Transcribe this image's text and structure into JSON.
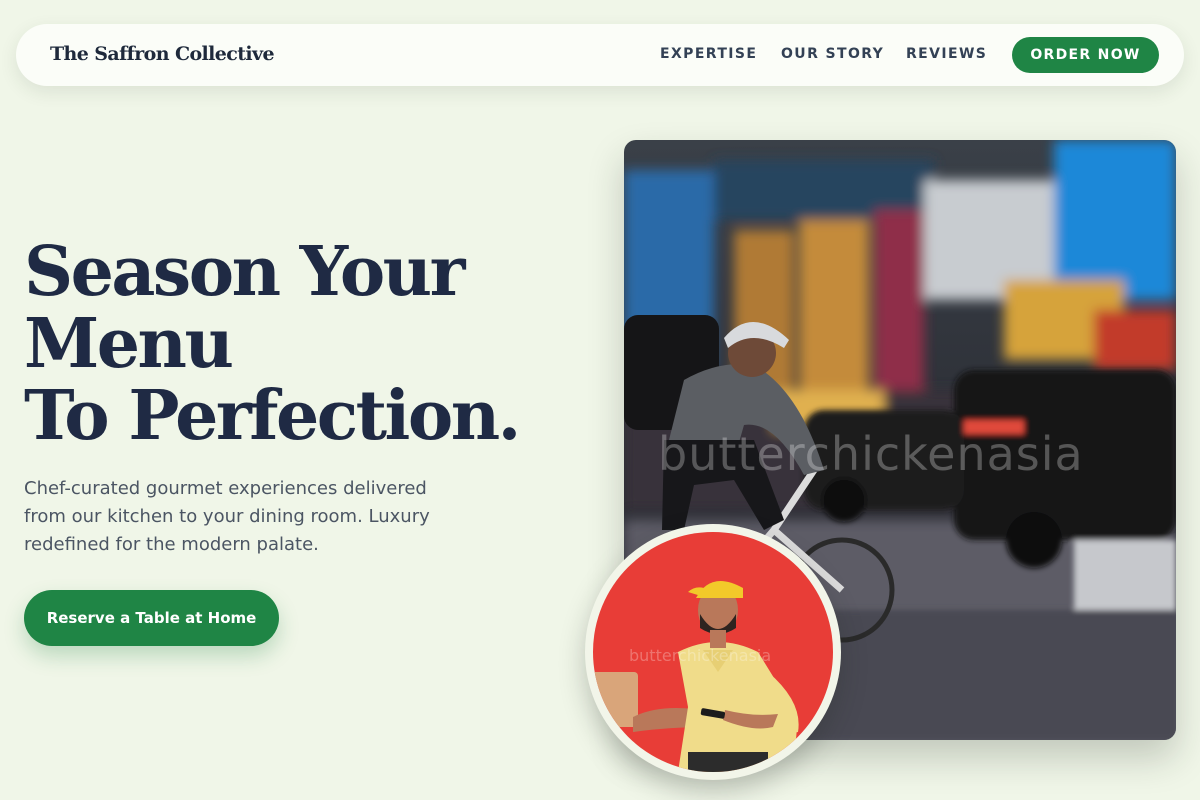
{
  "nav": {
    "brand": "The Saffron Collective",
    "links": [
      "EXPERTISE",
      "OUR STORY",
      "REVIEWS"
    ],
    "cta": "ORDER NOW"
  },
  "hero": {
    "headline_lines": [
      "Season Your",
      "Menu",
      "To Perfection."
    ],
    "subtitle": "Chef-curated gourmet experiences delivered from our kitchen to your dining room. Luxury redefined for the modern palate.",
    "cta": "Reserve a Table at Home",
    "main_image_watermark": "butterchickenasia",
    "circle_image_watermark": "butterchickenasia"
  },
  "colors": {
    "background": "#f0f6e8",
    "accent": "#1f8545",
    "heading": "#1f2a44",
    "circle_bg": "#e83d37"
  }
}
